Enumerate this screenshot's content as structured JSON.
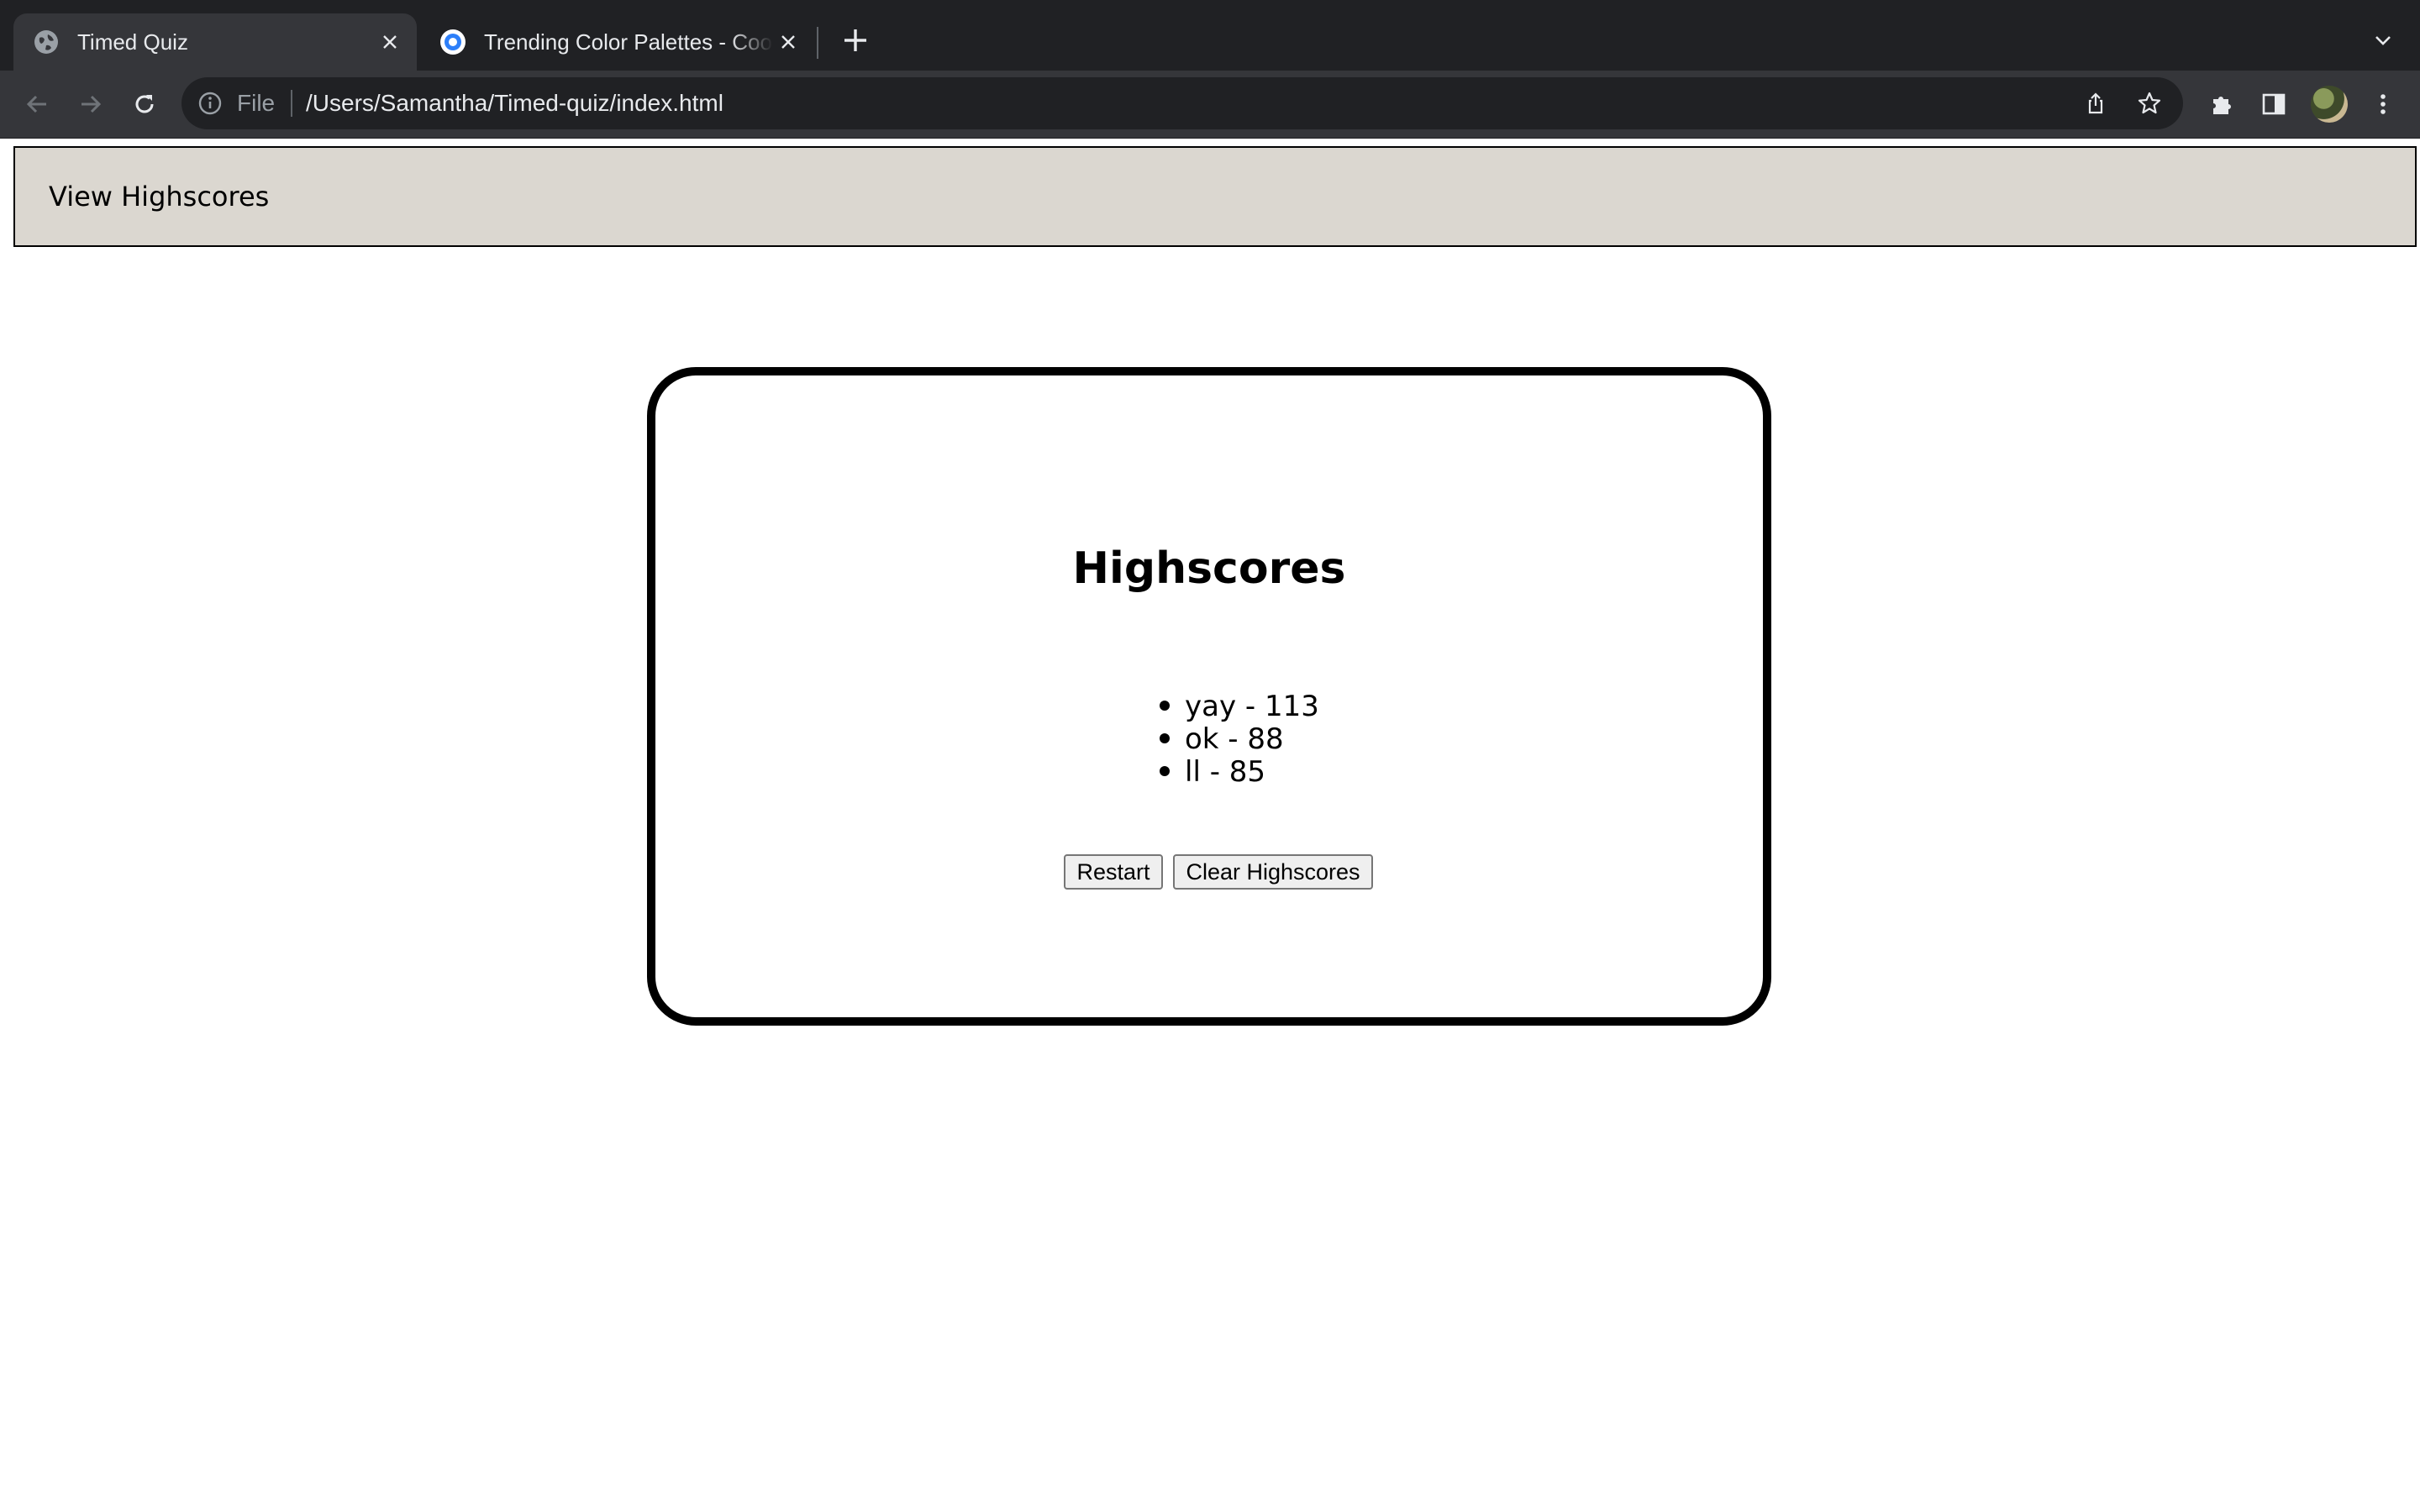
{
  "browser": {
    "tabs": [
      {
        "title": "Timed Quiz",
        "active": true,
        "favicon": "globe-icon"
      },
      {
        "title": "Trending Color Palettes - Coolors",
        "active": false,
        "favicon": "coolors-icon"
      }
    ],
    "address": {
      "scheme_label": "File",
      "url": "/Users/Samantha/Timed-quiz/index.html"
    },
    "colors": {
      "tabbar_bg": "#202124",
      "toolbar_bg": "#35363a",
      "coolors_blue": "#2d7ff9"
    }
  },
  "page": {
    "header": {
      "view_highscores_label": "View Highscores",
      "bg": "#dbd7d0"
    },
    "card": {
      "title": "Highscores",
      "scores": [
        {
          "text": "yay - 113"
        },
        {
          "text": "ok - 88"
        },
        {
          "text": "ll - 85"
        }
      ],
      "restart_label": "Restart",
      "clear_label": "Clear Highscores"
    }
  }
}
